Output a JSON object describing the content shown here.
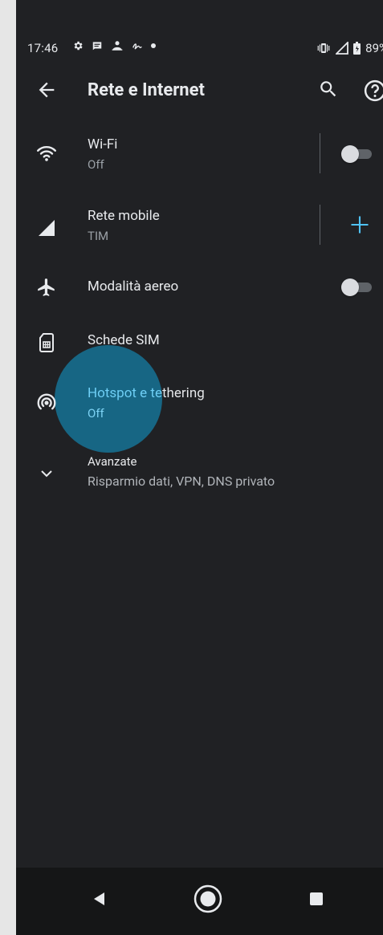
{
  "status_bar": {
    "time": "17:46",
    "battery": "89%"
  },
  "app_bar": {
    "title": "Rete e Internet"
  },
  "items": [
    {
      "title": "Wi-Fi",
      "subtitle": "Off",
      "icon": "wifi-icon",
      "toggle": false
    },
    {
      "title": "Rete mobile",
      "subtitle": "TIM",
      "icon": "signal-icon",
      "action": "+"
    },
    {
      "title": "Modalità aereo",
      "icon": "airplane-icon",
      "toggle": false
    },
    {
      "title": "Schede SIM",
      "icon": "sim-card-icon"
    },
    {
      "title": "Hotspot e tethering",
      "subtitle": "Off",
      "icon": "hotspot-icon"
    },
    {
      "title": "Avanzate",
      "subtitle": "Risparmio dati, VPN, DNS privato",
      "icon": "chevron-down-icon"
    }
  ],
  "colors": {
    "background": "#202124",
    "accent": "#4fc3f7",
    "ripple": "#176a8a",
    "text_primary": "#e8eaed",
    "text_secondary": "#9aa0a6"
  }
}
